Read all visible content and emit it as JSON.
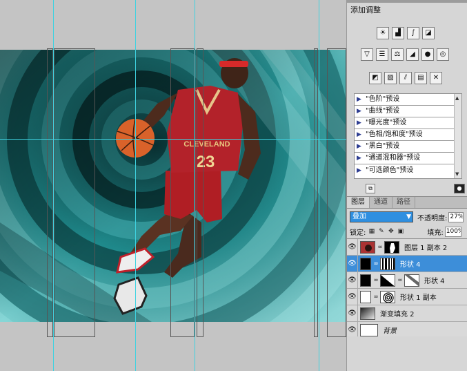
{
  "adjustments": {
    "title": "添加调整",
    "row1_icons": [
      "brightness-icon",
      "levels-icon",
      "curves-icon",
      "exposure-icon"
    ],
    "row2_icons": [
      "vibrance-icon",
      "hue-saturation-icon",
      "color-balance-icon",
      "black-white-icon",
      "photo-filter-icon",
      "channel-mixer-icon"
    ],
    "row3_icons": [
      "invert-icon",
      "posterize-icon",
      "threshold-icon",
      "gradient-map-icon",
      "selective-color-icon"
    ],
    "presets": [
      "\"色阶\"预设",
      "\"曲线\"预设",
      "\"曝光度\"预设",
      "\"色相/饱和度\"预设",
      "\"黑白\"预设",
      "\"通道混和器\"预设",
      "\"可选颜色\"预设"
    ]
  },
  "layers_panel": {
    "tabs": [
      "图层",
      "通道",
      "路径"
    ],
    "active_tab": "图层",
    "blend_mode": "叠加",
    "opacity_label": "不透明度:",
    "opacity_value": "27%",
    "lock_label": "锁定:",
    "fill_label": "填充:",
    "fill_value": "100%",
    "layers": [
      {
        "name": "图层 1 副本 2",
        "selected": false
      },
      {
        "name": "形状 4",
        "selected": true
      },
      {
        "name": "形状 4",
        "selected": false
      },
      {
        "name": "形状 1 副本",
        "selected": false
      },
      {
        "name": "渐变填充 2",
        "selected": false
      },
      {
        "name": "背景",
        "selected": false,
        "italic": true
      }
    ]
  },
  "canvas": {
    "jersey_text": "CLEVELAND",
    "jersey_number": "23",
    "guide_color": "#3fd2e0",
    "background_color": "#0f6b6e"
  },
  "colors": {
    "selection_blue": "#3d8ed9",
    "blend_select_blue": "#2f8fe0",
    "panel_gray": "#d6d6d6",
    "preset_triangle": "#2d3d91"
  }
}
